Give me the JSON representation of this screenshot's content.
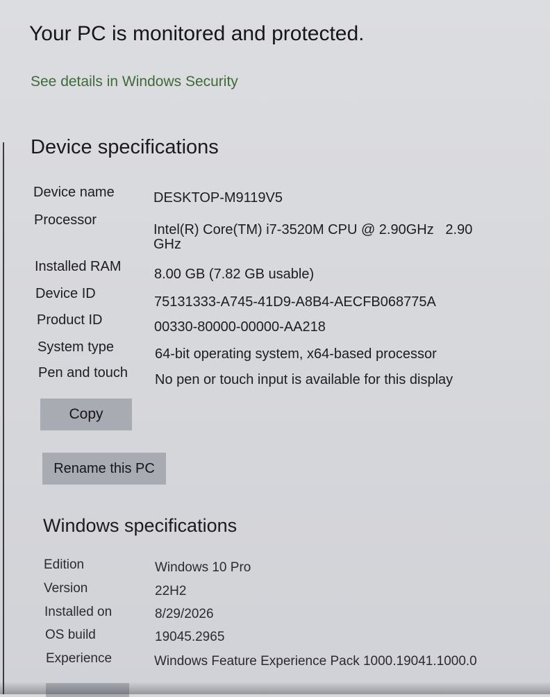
{
  "protection": {
    "title": "Your PC is monitored and protected.",
    "link_label": "See details in Windows Security"
  },
  "device_specs": {
    "title": "Device specifications",
    "rows": [
      {
        "label": "Device name",
        "value": "DESKTOP-M9119V5"
      },
      {
        "label": "Processor",
        "value": "Intel(R) Core(TM) i7-3520M CPU @ 2.90GHz   2.90",
        "value_line2": "GHz"
      },
      {
        "label": "Installed RAM",
        "value": "8.00 GB (7.82 GB usable)"
      },
      {
        "label": "Device ID",
        "value": "75131333-A745-41D9-A8B4-AECFB068775A"
      },
      {
        "label": "Product ID",
        "value": "00330-80000-00000-AA218"
      },
      {
        "label": "System type",
        "value": "64-bit operating system, x64-based processor"
      },
      {
        "label": "Pen and touch",
        "value": "No pen or touch input is available for this display"
      }
    ],
    "copy_label": "Copy",
    "rename_label": "Rename this PC"
  },
  "windows_specs": {
    "title": "Windows specifications",
    "rows": [
      {
        "label": "Edition",
        "value": "Windows 10 Pro"
      },
      {
        "label": "Version",
        "value": "22H2"
      },
      {
        "label": "Installed on",
        "value": "8/29/2026"
      },
      {
        "label": "OS build",
        "value": "19045.2965"
      },
      {
        "label": "Experience",
        "value": "Windows Feature Experience Pack 1000.19041.1000.0"
      }
    ]
  }
}
